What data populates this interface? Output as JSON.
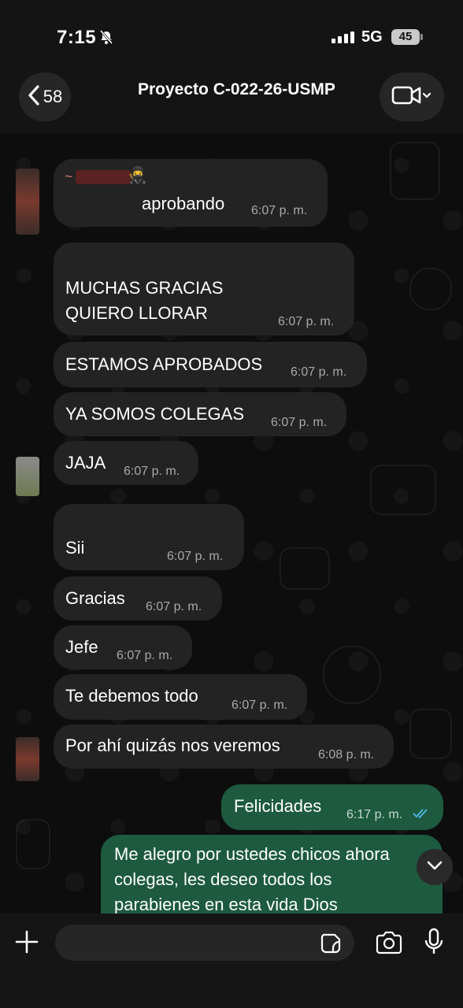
{
  "status_bar": {
    "time": "7:15",
    "network": "5G",
    "battery": "45"
  },
  "header": {
    "back_count": "58",
    "title": "Proyecto C-022-26-USMP"
  },
  "messages": [
    {
      "sender": "~",
      "text": "aprobando",
      "time": "6:07 p. m."
    },
    {
      "text_line1": "MUCHAS GRACIAS",
      "text_line2": "QUIERO LLORAR",
      "time": "6:07 p. m."
    },
    {
      "text": "ESTAMOS APROBADOS",
      "time": "6:07 p. m."
    },
    {
      "text": "YA SOMOS COLEGAS",
      "time": "6:07 p. m."
    },
    {
      "text": "JAJA",
      "time": "6:07 p. m."
    },
    {
      "text": "Sii",
      "time": "6:07 p. m."
    },
    {
      "text": "Gracias",
      "time": "6:07 p. m."
    },
    {
      "text": "Jefe",
      "time": "6:07 p. m."
    },
    {
      "text": "Te debemos todo",
      "time": "6:07 p. m."
    },
    {
      "text": "Por ahí quizás nos veremos",
      "time": "6:08 p. m."
    },
    {
      "text": "Felicidades",
      "time": "6:17 p. m.",
      "status": "read"
    },
    {
      "text_line1": "Me alegro por ustedes chicos ahora",
      "text_line2": "colegas, les deseo todos los",
      "text_line3": "parabienes en esta vida Dios"
    }
  ],
  "composer": {
    "placeholder": ""
  },
  "colors": {
    "incoming_bubble": "#232323",
    "outgoing_bubble": "#1d5a40",
    "read_ticks": "#53bdeb"
  },
  "icons": [
    "bell-slash-icon",
    "chevron-left-icon",
    "video-camera-icon",
    "chevron-down-icon",
    "plus-icon",
    "sticker-icon",
    "camera-icon",
    "microphone-icon",
    "double-check-icon"
  ]
}
